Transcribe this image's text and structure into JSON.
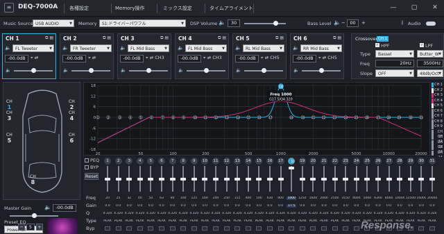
{
  "app": {
    "title": "DEQ-7000A",
    "logo_icon": "eq-logo-icon"
  },
  "menu": {
    "items": [
      "各種設定",
      "Memory操作",
      "ミックス設定",
      "タイムアライメント"
    ]
  },
  "window_controls": {
    "minimize": "—",
    "maximize": "▢",
    "close": "✕"
  },
  "source": {
    "music_source_label": "Music Source",
    "music_source_value": "USB AUDIO",
    "memory_label": "Memory",
    "memory_value": "S1:ドライバーパワフル",
    "dsp_volume_label": "DSP Volume",
    "dsp_volume_value": "30",
    "dsp_volume_level": 0.75,
    "bass_level_label": "Bass Level",
    "bass_level_value": "00",
    "bt_label": "Audio"
  },
  "channels": [
    {
      "name": "CH 1",
      "speaker": "FL Tweeter",
      "db": "-00.0dB",
      "link": "",
      "level": 0.5,
      "active": true
    },
    {
      "name": "CH 2",
      "speaker": "FR Tweeter",
      "db": "-00.0dB",
      "link": "",
      "level": 0.5,
      "active": false
    },
    {
      "name": "CH 3",
      "speaker": "FL Mid Bass",
      "db": "-00.0dB",
      "link": "CH3",
      "level": 0.5,
      "active": false
    },
    {
      "name": "CH 4",
      "speaker": "FL Mid Bass",
      "db": "-00.0dB",
      "link": "CH3",
      "level": 0.5,
      "active": false
    },
    {
      "name": "CH 5",
      "speaker": "RL Mid Bass",
      "db": "-00.0dB",
      "link": "CH5",
      "level": 0.5,
      "active": false
    },
    {
      "name": "CH 6",
      "speaker": "RR Mid Bass",
      "db": "-00.0dB",
      "link": "CH5",
      "level": 0.5,
      "active": false
    }
  ],
  "crossover": {
    "title": "Crossover",
    "ch_badge": "CH 1",
    "hpf_label": "HPF",
    "lpf_label": "LPF",
    "type_label": "Type",
    "type_hpf": "Bassel",
    "type_lpf": "Butter_W",
    "freq_label": "Freq",
    "freq_hpf": "20Hz",
    "freq_lpf": "3500Hz",
    "slope_label": "Slope",
    "slope_hpf": "OFF",
    "slope_lpf": "48db/Oct"
  },
  "car": {
    "speakers": [
      {
        "label": "CH",
        "num": "1"
      },
      {
        "label": "CH",
        "num": "2"
      },
      {
        "label": "CH",
        "num": "3"
      },
      {
        "label": "CH",
        "num": "4"
      },
      {
        "label": "CH",
        "num": "5"
      },
      {
        "label": "CH",
        "num": "6"
      },
      {
        "label": "CH",
        "num": "8"
      }
    ]
  },
  "graph": {
    "y_ticks": [
      "18",
      "12",
      "6",
      "0",
      "-6",
      "-12",
      "-18"
    ],
    "x_ticks": [
      "20",
      "50",
      "100",
      "200",
      "500",
      "1000",
      "2000",
      "5000",
      "10000",
      "20000"
    ],
    "tooltip_title": "Freq 1000",
    "tooltip_sub": "G17.5/Q4.320",
    "selected_band": "18",
    "legend": [
      "CH 1",
      "CH 2",
      "CH 3",
      "CH 4",
      "CH 5",
      "CH 6",
      "CH 7",
      "CH 8",
      "CH 9",
      "CH 10",
      "CH 11",
      "CH 12",
      "CH 13",
      "CH 14"
    ],
    "colors": {
      "ch1": "#2fb3e8",
      "ch3": "#d1307a",
      "ch4": "#e8e8e8"
    }
  },
  "eq": {
    "peq_label": "PEQ",
    "byp_label": "BYP",
    "reset_label": "Reset",
    "row_labels": [
      "Freq",
      "Gain",
      "Q",
      "Type",
      "Byp"
    ],
    "bands": [
      "1",
      "2",
      "3",
      "4",
      "5",
      "6",
      "7",
      "8",
      "9",
      "10",
      "11",
      "12",
      "13",
      "14",
      "15",
      "16",
      "17",
      "18",
      "19",
      "20",
      "21",
      "22",
      "23",
      "24",
      "25",
      "26",
      "27",
      "28",
      "29",
      "30",
      "31"
    ],
    "freqs": [
      "20",
      "25",
      "32",
      "40",
      "50",
      "63",
      "80",
      "100",
      "125",
      "160",
      "200",
      "250",
      "315",
      "400",
      "500",
      "630",
      "800",
      "1000",
      "1250",
      "1600",
      "2000",
      "2500",
      "3150",
      "4000",
      "5000",
      "6300",
      "8000",
      "10000",
      "12500",
      "16000",
      "20000"
    ],
    "gains": [
      "0.0",
      "0.0",
      "0.0",
      "0.0",
      "0.0",
      "0.0",
      "0.0",
      "0.0",
      "0.0",
      "0.0",
      "0.0",
      "0.0",
      "0.0",
      "0.0",
      "0.0",
      "0.0",
      "0.0",
      "17.5",
      "0.0",
      "0.0",
      "0.0",
      "0.0",
      "0.0",
      "0.0",
      "0.0",
      "0.0",
      "0.0",
      "0.0",
      "0.0",
      "0.0",
      "0.0"
    ],
    "q": "4.320",
    "type": "PEAK",
    "selected_index": 17
  },
  "master": {
    "gain_label": "Master Gain",
    "gain_value": "-00.0dB",
    "gain_level": 0.5,
    "preset_label": "Preset EQ",
    "preset_value": "Powerfull",
    "level_label": "Level",
    "level_value": "5",
    "minus": "−",
    "plus": "+"
  },
  "watermark": "Response."
}
